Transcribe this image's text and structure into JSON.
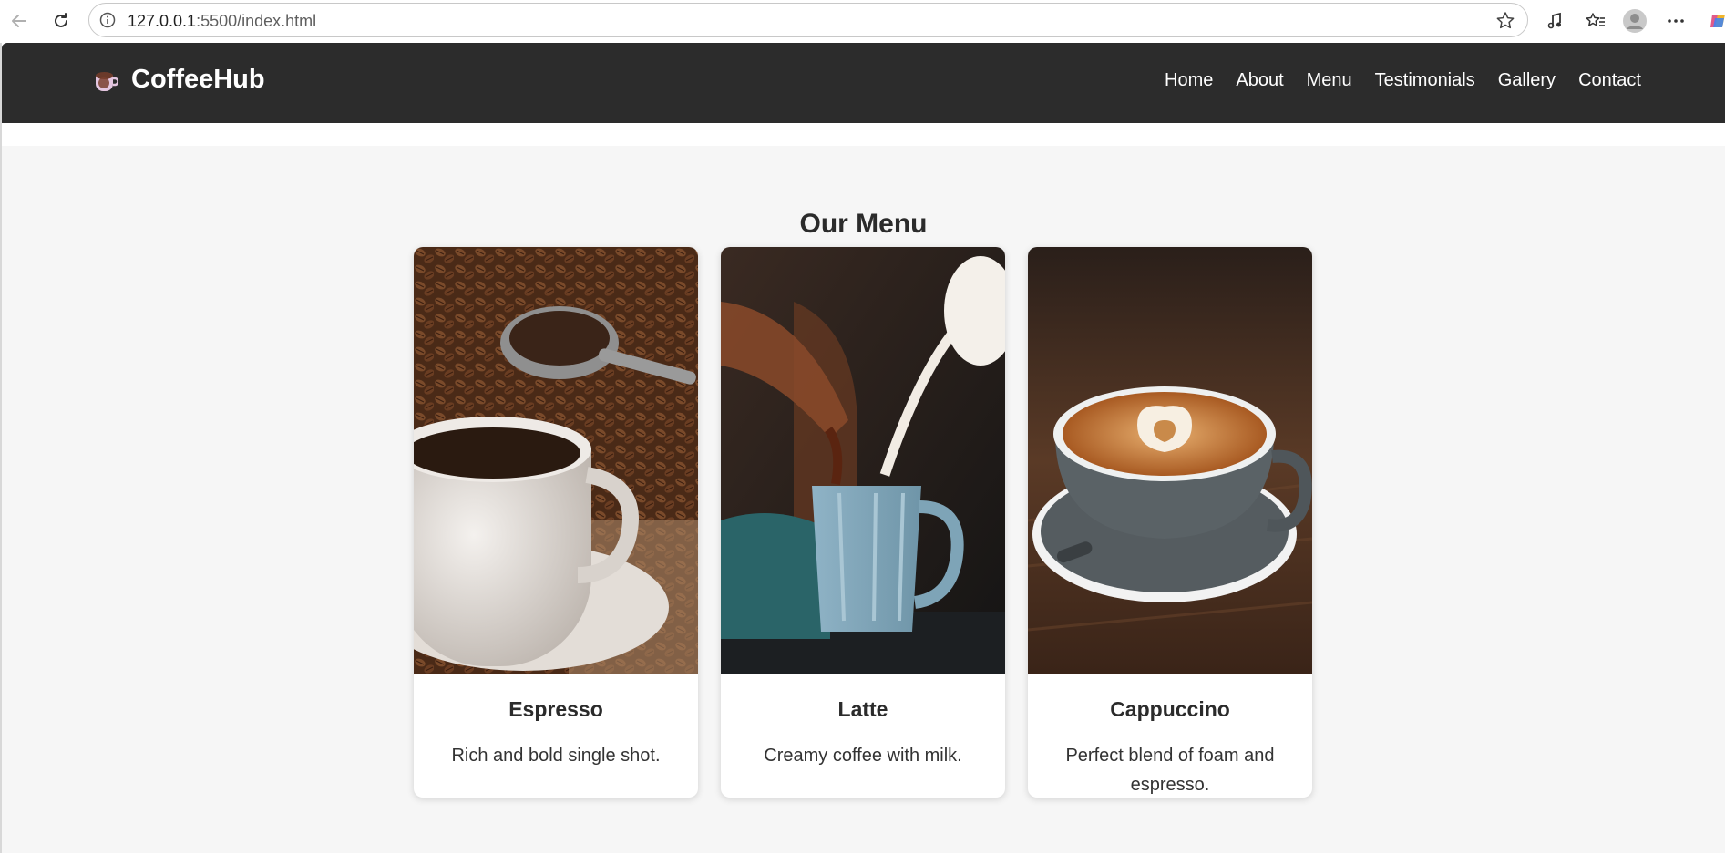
{
  "browser": {
    "url_host": "127.0.0.1",
    "url_rest": ":5500/index.html"
  },
  "site": {
    "brand": "CoffeeHub",
    "nav": [
      "Home",
      "About",
      "Menu",
      "Testimonials",
      "Gallery",
      "Contact"
    ]
  },
  "menu": {
    "title": "Our Menu",
    "items": [
      {
        "name": "Espresso",
        "description": "Rich and bold single shot."
      },
      {
        "name": "Latte",
        "description": "Creamy coffee with milk."
      },
      {
        "name": "Cappuccino",
        "description": "Perfect blend of foam and espresso."
      }
    ]
  },
  "colors": {
    "header_bg": "#2c2c2c",
    "section_bg": "#f6f6f6",
    "text_dark": "#2b2b2b"
  }
}
